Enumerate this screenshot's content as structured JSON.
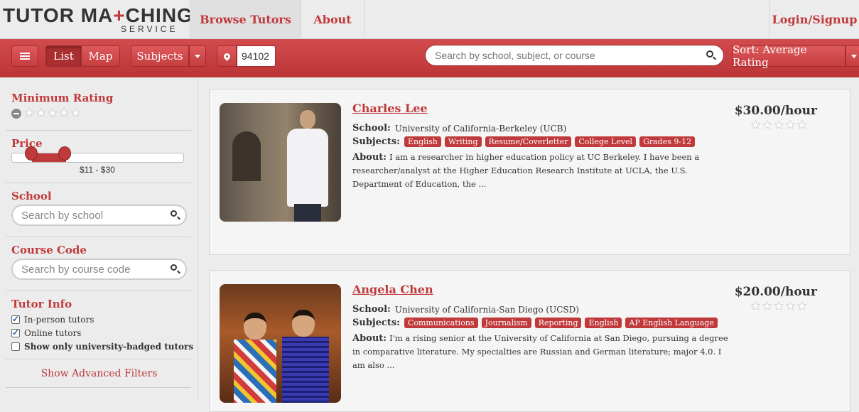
{
  "logo": {
    "main_pre": "TUTOR MA",
    "main_red": "+",
    "main_post": "CHING",
    "sub": "SERVICE"
  },
  "topnav": {
    "browse": "Browse Tutors",
    "about": "About",
    "login": "Login/Signup"
  },
  "toolbar": {
    "list": "List",
    "map": "Map",
    "subjects": "Subjects",
    "zip": "94102",
    "search_placeholder": "Search by school, subject, or course",
    "sort": "Sort: Average Rating"
  },
  "sidebar": {
    "min_rating_title": "Minimum Rating",
    "min_rating_value": 0,
    "price_title": "Price",
    "price_range": "$11 - $30",
    "price_min": 11,
    "price_max": 30,
    "school_title": "School",
    "school_placeholder": "Search by school",
    "course_title": "Course Code",
    "course_placeholder": "Search by course code",
    "tutor_info_title": "Tutor Info",
    "options": [
      {
        "label": "In-person tutors",
        "checked": true
      },
      {
        "label": "Online tutors",
        "checked": true
      },
      {
        "label": "Show only university-badged tutors",
        "checked": false
      }
    ],
    "advanced": "Show Advanced Filters"
  },
  "labels": {
    "school": "School:",
    "subjects": "Subjects:",
    "about": "About:"
  },
  "tutors": [
    {
      "name": "Charles Lee",
      "school": "University of California-Berkeley (UCB)",
      "subjects": [
        "English",
        "Writing",
        "Resume/Coverletter",
        "College Level",
        "Grades 9-12"
      ],
      "about": "I am a researcher in higher education policy at UC Berkeley. I have been a researcher/analyst at the Higher Education Research Institute at UCLA, the U.S. Department of Education, the ...",
      "rate": "$30.00/hour",
      "rating": 0
    },
    {
      "name": "Angela Chen",
      "school": "University of California-San Diego (UCSD)",
      "subjects": [
        "Communications",
        "Journalism",
        "Reporting",
        "English",
        "AP English Language"
      ],
      "about": "I'm a rising senior at the University of California at San Diego, pursuing a degree in comparative literature. My specialties are Russian and German literature; major 4.0. I am also ...",
      "rate": "$20.00/hour",
      "rating": 0
    }
  ],
  "colors": {
    "brand_red": "#c0393b",
    "toolbar_red": "#c53e40",
    "background": "#ececec"
  }
}
